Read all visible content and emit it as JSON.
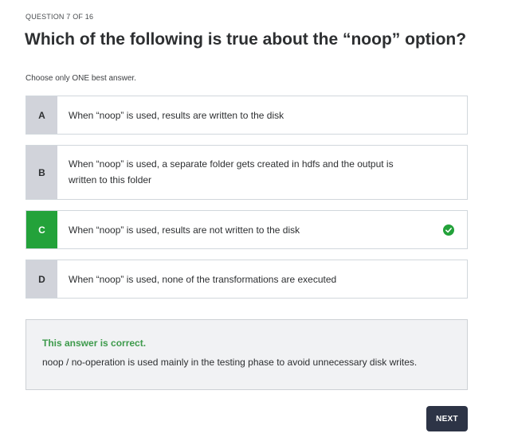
{
  "question": {
    "counter": "QUESTION 7 OF 16",
    "title": "Which of the following is true about the “noop” option?",
    "instruction": "Choose only ONE best answer."
  },
  "options": [
    {
      "letter": "A",
      "text": "When “noop” is used, results are written to the disk",
      "selected": false
    },
    {
      "letter": "B",
      "text": "When “noop” is used, a separate folder gets created in hdfs and the output is written to this folder",
      "selected": false
    },
    {
      "letter": "C",
      "text": "When “noop” is used, results are not written to the disk",
      "selected": true,
      "correct": true
    },
    {
      "letter": "D",
      "text": "When “noop” is used, none of the transformations are executed",
      "selected": false
    }
  ],
  "feedback": {
    "heading": "This answer is correct.",
    "explanation": "noop / no-operation is used mainly in the testing phase to avoid unnecessary disk writes."
  },
  "next_button": "NEXT",
  "colors": {
    "correct": "#23a23a",
    "letter_bg": "#d1d3da",
    "button_bg": "#2d3446",
    "feedback_head": "#3d9a4b"
  },
  "icons": {
    "correct_mark": "check-circle-icon"
  }
}
